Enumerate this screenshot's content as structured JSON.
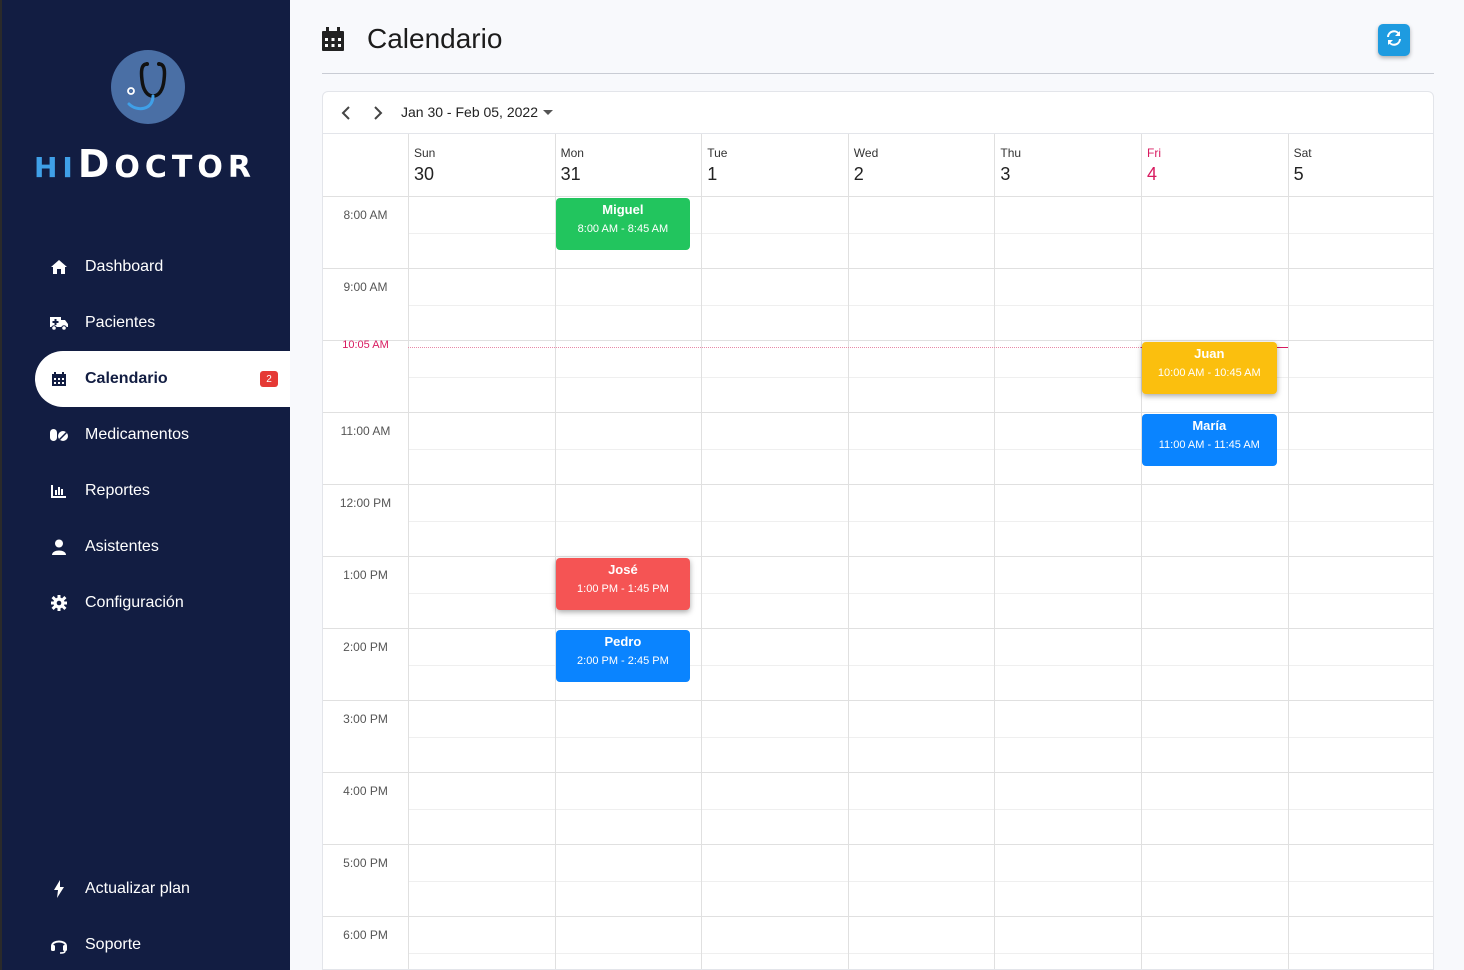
{
  "brand": {
    "hi": "HI",
    "doc_cap": "D",
    "doc_rest": "OCTOR"
  },
  "sidebar": {
    "items": [
      {
        "label": "Dashboard",
        "icon": "home-icon"
      },
      {
        "label": "Pacientes",
        "icon": "ambulance-icon"
      },
      {
        "label": "Calendario",
        "icon": "calendar-icon",
        "badge": "2",
        "active": true
      },
      {
        "label": "Medicamentos",
        "icon": "pills-icon"
      },
      {
        "label": "Reportes",
        "icon": "chart-icon"
      },
      {
        "label": "Asistentes",
        "icon": "user-icon"
      },
      {
        "label": "Configuración",
        "icon": "gear-icon"
      }
    ],
    "bottom": [
      {
        "label": "Actualizar plan",
        "icon": "bolt-icon"
      },
      {
        "label": "Soporte",
        "icon": "headset-icon"
      }
    ]
  },
  "header": {
    "title": "Calendario",
    "refresh_icon": "refresh-icon"
  },
  "calendar": {
    "range": "Jan 30 - Feb 05, 2022",
    "days": [
      {
        "name": "Sun",
        "date": "30"
      },
      {
        "name": "Mon",
        "date": "31"
      },
      {
        "name": "Tue",
        "date": "1"
      },
      {
        "name": "Wed",
        "date": "2"
      },
      {
        "name": "Thu",
        "date": "3"
      },
      {
        "name": "Fri",
        "date": "4",
        "today": true
      },
      {
        "name": "Sat",
        "date": "5"
      }
    ],
    "hours": [
      "8:00 AM",
      "9:00 AM",
      "10:00 AM",
      "11:00 AM",
      "12:00 PM",
      "1:00 PM",
      "2:00 PM",
      "3:00 PM",
      "4:00 PM",
      "5:00 PM",
      "6:00 PM"
    ],
    "now_label": "10:05 AM",
    "events": [
      {
        "name": "Miguel",
        "time": "8:00 AM - 8:45 AM",
        "color": "#22c55e"
      },
      {
        "name": "Juan",
        "time": "10:00 AM - 10:45 AM",
        "color": "#fbbf0e"
      },
      {
        "name": "María",
        "time": "11:00 AM - 11:45 AM",
        "color": "#0a84ff"
      },
      {
        "name": "José",
        "time": "1:00 PM - 1:45 PM",
        "color": "#f55454"
      },
      {
        "name": "Pedro",
        "time": "2:00 PM - 2:45 PM",
        "color": "#0a84ff"
      }
    ]
  },
  "colors": {
    "sidebar_bg": "#121d42",
    "accent": "#1e9be0",
    "today": "#d81b60",
    "badge": "#e53935"
  }
}
